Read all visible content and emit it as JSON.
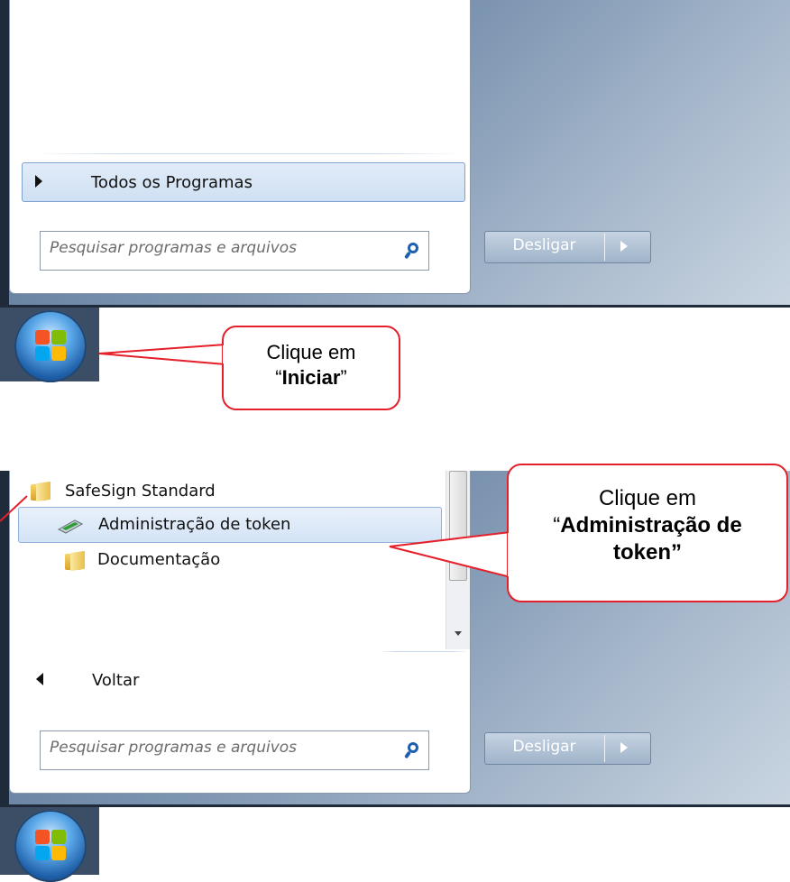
{
  "top_menu": {
    "all_programs_label": "Todos os Programas",
    "search_placeholder": "Pesquisar programas e arquivos",
    "shutdown_label": "Desligar"
  },
  "top_callout": {
    "line1": "Clique em",
    "quote_open": "“",
    "bold": "Iniciar",
    "quote_close": "”"
  },
  "bottom_menu": {
    "folder_label": "SafeSign Standard",
    "items": [
      {
        "label": "Administração de token",
        "icon": "token-admin-icon"
      },
      {
        "label": "Documentação",
        "icon": "folder-icon"
      }
    ],
    "back_label": "Voltar",
    "search_placeholder": "Pesquisar programas e arquivos",
    "shutdown_label": "Desligar"
  },
  "bottom_callout": {
    "line1": "Clique em",
    "quote_open": "“",
    "bold_line1": "Administração de",
    "bold_line2": "token”"
  },
  "colors": {
    "callout_border": "#e4202a",
    "menu_accent": "#1f5fb0"
  }
}
